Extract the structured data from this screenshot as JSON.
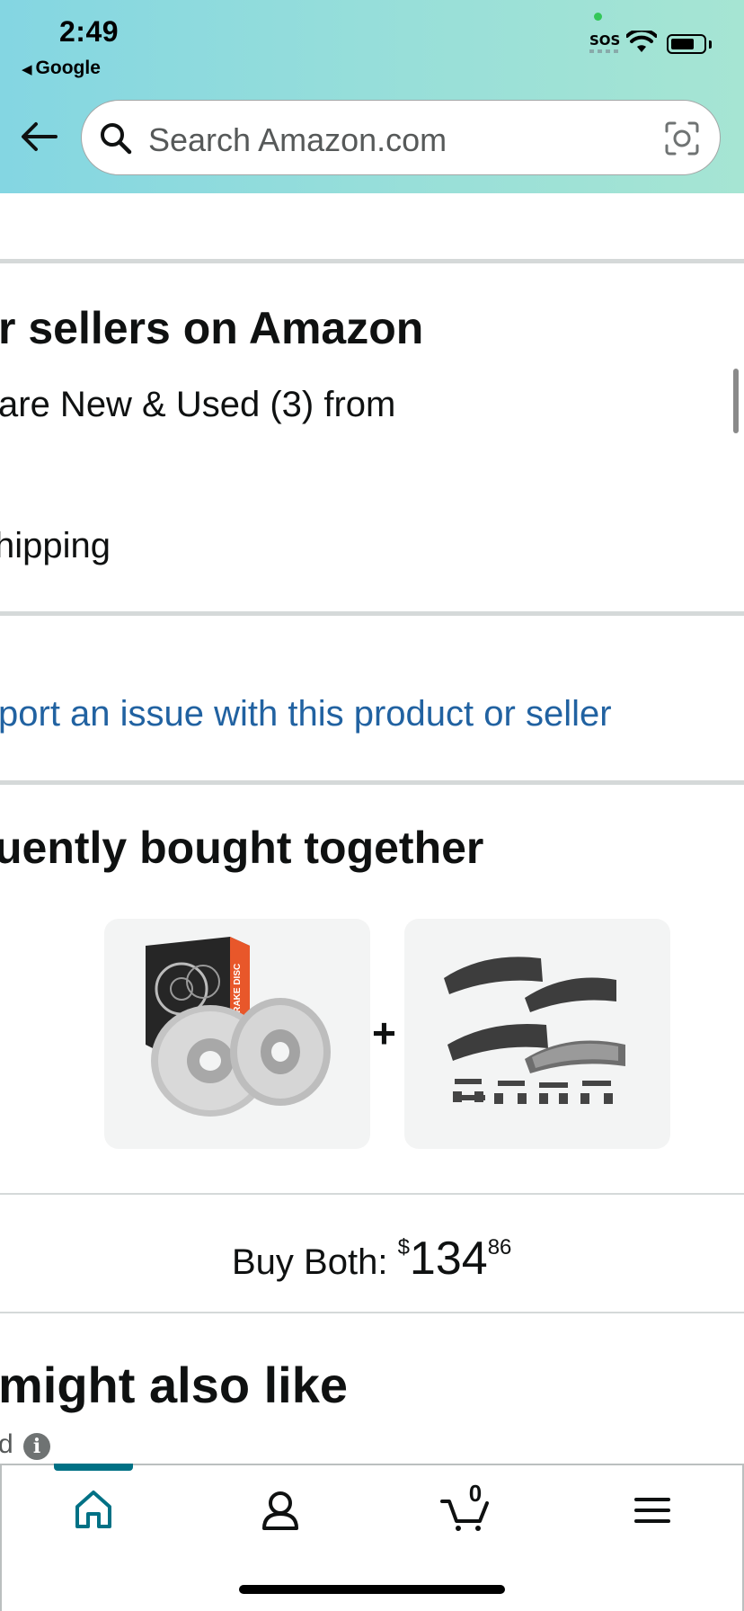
{
  "status_bar": {
    "time": "2:49",
    "back_app": "Google",
    "sos": "SOS"
  },
  "search": {
    "placeholder": "Search Amazon.com"
  },
  "other_sellers": {
    "title": "r sellers on Amazon",
    "compare": "are New & Used (3) from",
    "shipping": "hipping"
  },
  "report": {
    "link": "port an issue with this product or seller"
  },
  "bought_together": {
    "title": "uently bought together",
    "plus": "+",
    "products": [
      {
        "name": "brake-disc-rotors",
        "box_label": "BRAKE DISC"
      },
      {
        "name": "brake-pads-set"
      }
    ]
  },
  "buy_both": {
    "label": "Buy Both: ",
    "currency": "$",
    "dollars": "134",
    "cents": "86"
  },
  "might_like": {
    "title": "might also like",
    "sponsored_fragment": "d"
  },
  "bottom_nav": {
    "items": [
      "home-icon",
      "account-icon",
      "cart-icon",
      "menu-icon"
    ],
    "cart_count": "0",
    "active": "home"
  },
  "colors": {
    "header_gradient_start": "#84d6e2",
    "header_gradient_end": "#a6e5d3",
    "link": "#2162a1",
    "nav_active": "#007185",
    "divider": "#d5d9d9"
  }
}
